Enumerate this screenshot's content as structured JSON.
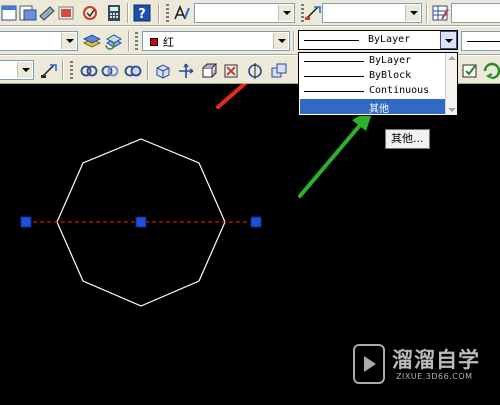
{
  "layer_color": {
    "label": "红",
    "swatch": "#e00000"
  },
  "linetype": {
    "selected": "ByLayer",
    "options": [
      "ByLayer",
      "ByBlock",
      "Continuous",
      "其他"
    ],
    "highlighted": "其他"
  },
  "tooltip": "其他...",
  "canvas": {
    "background": "#000000",
    "shape": "octagon",
    "shape_color": "#ffffff",
    "centerline_color": "#ff2020",
    "grip_color": "#1e50d8"
  },
  "annotations": {
    "red_arrow": "#e82a1a",
    "green_arrow": "#2ab32a"
  },
  "watermark": {
    "name": "溜溜自学",
    "url": "ZIXUE.3D66.COM"
  }
}
